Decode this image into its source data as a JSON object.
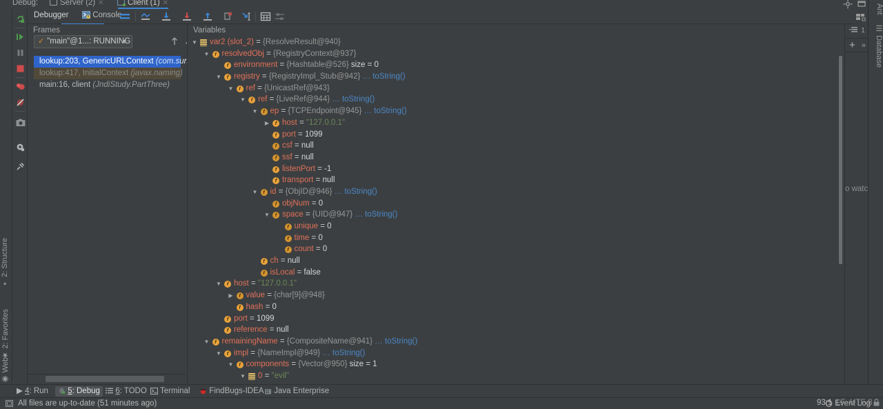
{
  "window": {
    "top_tabs": [
      {
        "label": "Debug:",
        "type": "label"
      },
      {
        "label": "Server (2)",
        "icon": "console-icon",
        "selected": false,
        "closable": true
      },
      {
        "label": "Client (1)",
        "icon": "console-icon",
        "selected": true,
        "closable": true
      }
    ]
  },
  "debug_toolbar": {
    "tabs": [
      {
        "label": "Debugger",
        "icon": "debugger-icon",
        "selected": true
      },
      {
        "label": "Console",
        "icon": "console-icon",
        "selected": false
      }
    ],
    "actions": [
      {
        "name": "mute-breakpoints-icon"
      },
      {
        "name": "show-execution-point-icon"
      },
      {
        "name": "step-over-icon"
      },
      {
        "name": "step-into-icon"
      },
      {
        "name": "step-out-icon"
      },
      {
        "name": "force-step-into-icon"
      },
      {
        "name": "run-to-cursor-icon"
      },
      {
        "name": "evaluate-expression-icon"
      },
      {
        "name": "settings-icon"
      }
    ]
  },
  "vertical_toolbar": [
    {
      "name": "rerun-icon"
    },
    {
      "name": "resume-program-icon"
    },
    {
      "name": "pause-program-icon"
    },
    {
      "name": "stop-icon"
    },
    {
      "name": "view-breakpoints-icon"
    },
    {
      "name": "mute-breakpoints-icon"
    },
    {
      "name": "screenshot-icon"
    },
    {
      "name": "settings-gear-icon"
    },
    {
      "name": "pin-tab-icon"
    }
  ],
  "frames": {
    "header": "Frames",
    "thread_selector": {
      "value": "\"main\"@1...: RUNNING",
      "status_icon": "checkmark-icon",
      "dropdown_icon": "chevron-down-icon"
    },
    "buttons": [
      {
        "name": "frame-up-button",
        "icon": "arrow-up-icon"
      },
      {
        "name": "frame-down-button",
        "icon": "arrow-down-icon"
      },
      {
        "name": "filter-frames-button",
        "icon": "filter-icon"
      }
    ],
    "rows": [
      {
        "text": "lookup:203, GenericURLContext ",
        "italic": "(com.sun.j",
        "state": "selected"
      },
      {
        "text": "lookup:417, InitialContext ",
        "italic": "(javax.naming)",
        "state": "highlighted"
      },
      {
        "text": "main:16, client ",
        "italic": "(JndiStudy.PartThree)",
        "state": "normal"
      }
    ]
  },
  "variables": {
    "header": "Variables",
    "rows": [
      {
        "depth": 0,
        "arrow": "down",
        "icon": "array-icon",
        "name": "var2 (slot_2)",
        "value": "{ResolveResult@940}",
        "vtype": "obj"
      },
      {
        "depth": 1,
        "arrow": "down",
        "icon": "field-icon",
        "name": "resolvedObj",
        "value": "{RegistryContext@937}",
        "vtype": "obj"
      },
      {
        "depth": 2,
        "arrow": "none",
        "icon": "field-icon",
        "name": "environment",
        "value": "{Hashtable@526}",
        "vtype": "obj",
        "extra": "size = 0"
      },
      {
        "depth": 2,
        "arrow": "down",
        "icon": "field-icon",
        "name": "registry",
        "value": "{RegistryImpl_Stub@942}",
        "vtype": "obj",
        "tostring": "… toString()"
      },
      {
        "depth": 3,
        "arrow": "down",
        "icon": "field-icon",
        "name": "ref",
        "value": "{UnicastRef@943}",
        "vtype": "obj"
      },
      {
        "depth": 4,
        "arrow": "down",
        "icon": "field-icon",
        "name": "ref",
        "value": "{LiveRef@944}",
        "vtype": "obj",
        "tostring": "… toString()"
      },
      {
        "depth": 5,
        "arrow": "down",
        "icon": "field-shaded-icon",
        "name": "ep",
        "value": "{TCPEndpoint@945}",
        "vtype": "obj",
        "tostring": "… toString()"
      },
      {
        "depth": 6,
        "arrow": "right",
        "icon": "field-icon",
        "name": "host",
        "value": "\"127.0.0.1\"",
        "vtype": "str"
      },
      {
        "depth": 6,
        "arrow": "none",
        "icon": "field-icon",
        "name": "port",
        "value": "1099",
        "vtype": "num"
      },
      {
        "depth": 6,
        "arrow": "none",
        "icon": "field-shaded-icon",
        "name": "csf",
        "value": "null",
        "vtype": "null"
      },
      {
        "depth": 6,
        "arrow": "none",
        "icon": "field-shaded-icon",
        "name": "ssf",
        "value": "null",
        "vtype": "null"
      },
      {
        "depth": 6,
        "arrow": "none",
        "icon": "field-icon",
        "name": "listenPort",
        "value": "-1",
        "vtype": "num"
      },
      {
        "depth": 6,
        "arrow": "none",
        "icon": "field-icon",
        "name": "transport",
        "value": "null",
        "vtype": "null"
      },
      {
        "depth": 5,
        "arrow": "down",
        "icon": "field-shaded-icon",
        "name": "id",
        "value": "{ObjID@946}",
        "vtype": "obj",
        "tostring": "… toString()"
      },
      {
        "depth": 6,
        "arrow": "none",
        "icon": "field-shaded-icon",
        "name": "objNum",
        "value": "0",
        "vtype": "num"
      },
      {
        "depth": 6,
        "arrow": "down",
        "icon": "field-shaded-icon",
        "name": "space",
        "value": "{UID@947}",
        "vtype": "obj",
        "tostring": "… toString()"
      },
      {
        "depth": 7,
        "arrow": "none",
        "icon": "field-shaded-icon",
        "name": "unique",
        "value": "0",
        "vtype": "num"
      },
      {
        "depth": 7,
        "arrow": "none",
        "icon": "field-shaded-icon",
        "name": "time",
        "value": "0",
        "vtype": "num"
      },
      {
        "depth": 7,
        "arrow": "none",
        "icon": "field-shaded-icon",
        "name": "count",
        "value": "0",
        "vtype": "num"
      },
      {
        "depth": 5,
        "arrow": "none",
        "icon": "field-icon",
        "name": "ch",
        "value": "null",
        "vtype": "null"
      },
      {
        "depth": 5,
        "arrow": "none",
        "icon": "field-shaded-icon",
        "name": "isLocal",
        "value": "false",
        "vtype": "num"
      },
      {
        "depth": 2,
        "arrow": "down",
        "icon": "field-icon",
        "name": "host",
        "value": "\"127.0.0.1\"",
        "vtype": "str"
      },
      {
        "depth": 3,
        "arrow": "right",
        "icon": "field-shaded-icon",
        "name": "value",
        "value": "{char[9]@948}",
        "vtype": "obj"
      },
      {
        "depth": 3,
        "arrow": "none",
        "icon": "field-icon",
        "name": "hash",
        "value": "0",
        "vtype": "num"
      },
      {
        "depth": 2,
        "arrow": "none",
        "icon": "field-icon",
        "name": "port",
        "value": "1099",
        "vtype": "num"
      },
      {
        "depth": 2,
        "arrow": "none",
        "icon": "field-icon",
        "name": "reference",
        "value": "null",
        "vtype": "null"
      },
      {
        "depth": 1,
        "arrow": "down",
        "icon": "field-icon",
        "name": "remainingName",
        "value": "{CompositeName@941}",
        "vtype": "obj",
        "tostring": "… toString()"
      },
      {
        "depth": 2,
        "arrow": "down",
        "icon": "field-icon",
        "name": "impl",
        "value": "{NameImpl@949}",
        "vtype": "obj",
        "tostring": "… toString()"
      },
      {
        "depth": 3,
        "arrow": "down",
        "icon": "field-icon",
        "name": "components",
        "value": "{Vector@950}",
        "vtype": "obj",
        "extra": "size = 1"
      },
      {
        "depth": 4,
        "arrow": "down",
        "icon": "array-icon",
        "name": "0",
        "value": "\"evil\"",
        "vtype": "str"
      }
    ]
  },
  "watches": {
    "count_label": "1",
    "add_label": "+",
    "more_label": "»",
    "empty_text": "o watche"
  },
  "left_rail": [
    {
      "label": "2: Structure",
      "icon": "structure-icon"
    },
    {
      "label": "2: Favorites",
      "icon": "star-icon"
    },
    {
      "label": "Web",
      "icon": "web-icon"
    }
  ],
  "right_rail": [
    {
      "label": "Ant",
      "icon": "ant-icon"
    },
    {
      "label": "Database",
      "icon": "database-icon"
    }
  ],
  "bottom_bar": [
    {
      "num": "4",
      "label": ": Run",
      "icon": "run-icon",
      "selected": false
    },
    {
      "num": "5",
      "label": ": Debug",
      "icon": "debug-icon",
      "selected": true
    },
    {
      "num": "6",
      "label": ": TODO",
      "icon": "todo-icon",
      "selected": false
    },
    {
      "num": "",
      "label": "Terminal",
      "icon": "terminal-icon",
      "selected": false
    },
    {
      "num": "",
      "label": "FindBugs-IDEA",
      "icon": "findbugs-icon",
      "selected": false
    },
    {
      "num": "",
      "label": "Java Enterprise",
      "icon": "java-enterprise-icon",
      "selected": false
    }
  ],
  "status_bar": {
    "message": "All files are up-to-date (51 minutes ago)",
    "event_log": "Event Log",
    "caret": "93:1",
    "line_sep": "LF",
    "encoding": "UTF-8"
  },
  "colors": {
    "background": "#3c3f41",
    "accent_blue": "#3d87d4",
    "selection_blue": "#2f65ca",
    "field_orange": "#e8a33d",
    "name_red": "#e0715a",
    "string_green": "#6a8759",
    "tostring_blue": "#4b87c7"
  }
}
